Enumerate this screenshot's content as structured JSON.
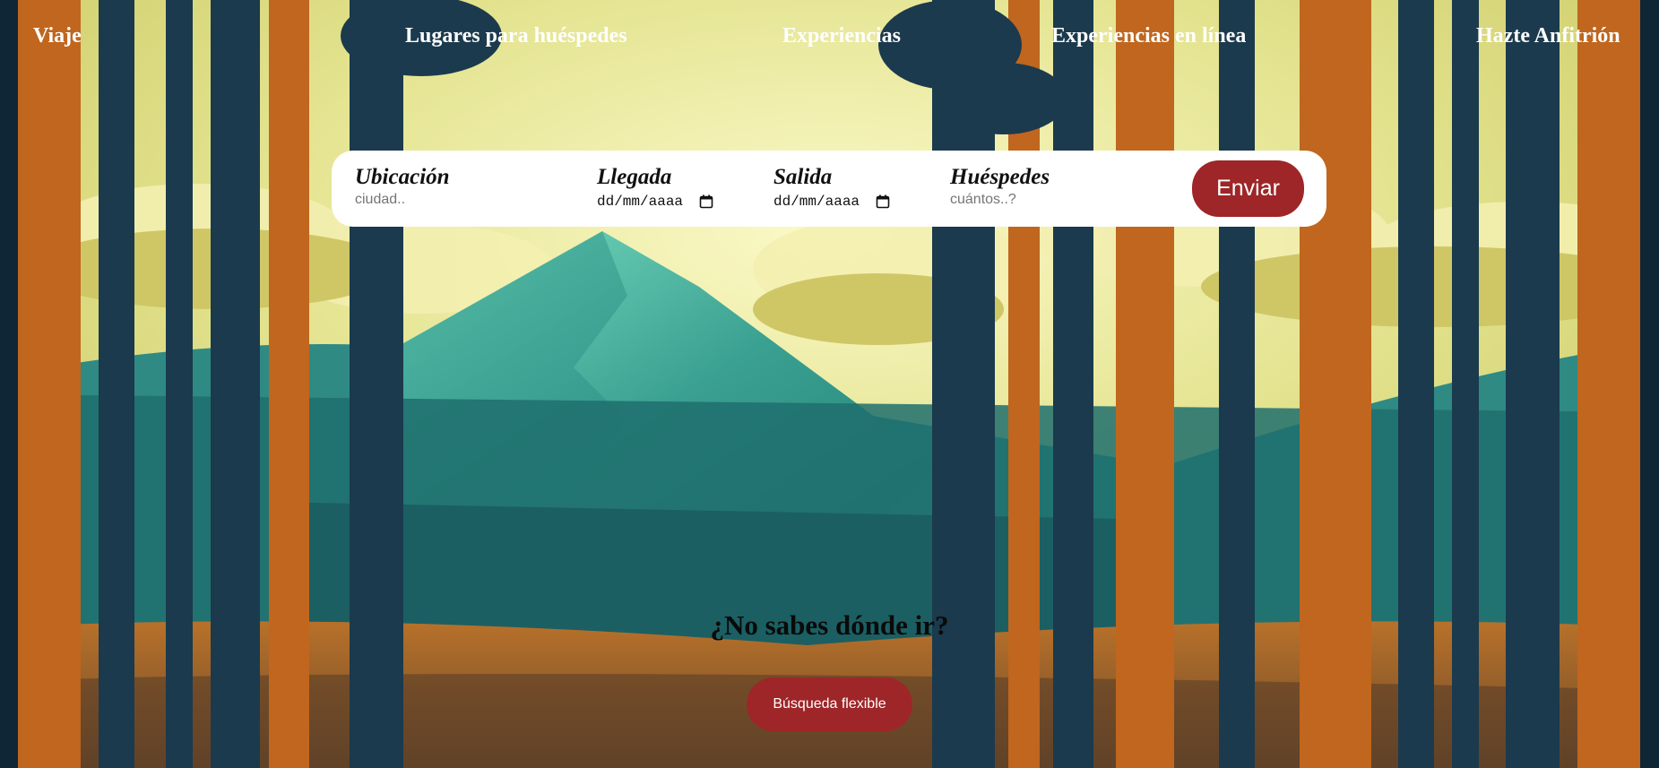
{
  "nav": {
    "items": [
      "Viaje",
      "Lugares para huéspedes",
      "Experiencias",
      "Experiencias en línea",
      "Hazte Anfitrión"
    ]
  },
  "search": {
    "location": {
      "label": "Ubicación",
      "placeholder": "ciudad.."
    },
    "checkin": {
      "label": "Llegada",
      "value": "dd/mm/aaaa"
    },
    "checkout": {
      "label": "Salida",
      "value": "dd/mm/aaaa"
    },
    "guests": {
      "label": "Huéspedes",
      "placeholder": "cuántos..?"
    },
    "submit_label": "Enviar"
  },
  "hero": {
    "question": "¿No sabes dónde ir?",
    "button_label": "Búsqueda flexible"
  },
  "colors": {
    "accent": "#9e2628",
    "sky": "#e8e69a",
    "mountain": "#3aa091",
    "trunk_orange": "#c0661e",
    "trunk_dark": "#1b3a4d"
  },
  "icons": {
    "calendar": "calendar-icon",
    "scene": "forest-mountain-illustration"
  }
}
